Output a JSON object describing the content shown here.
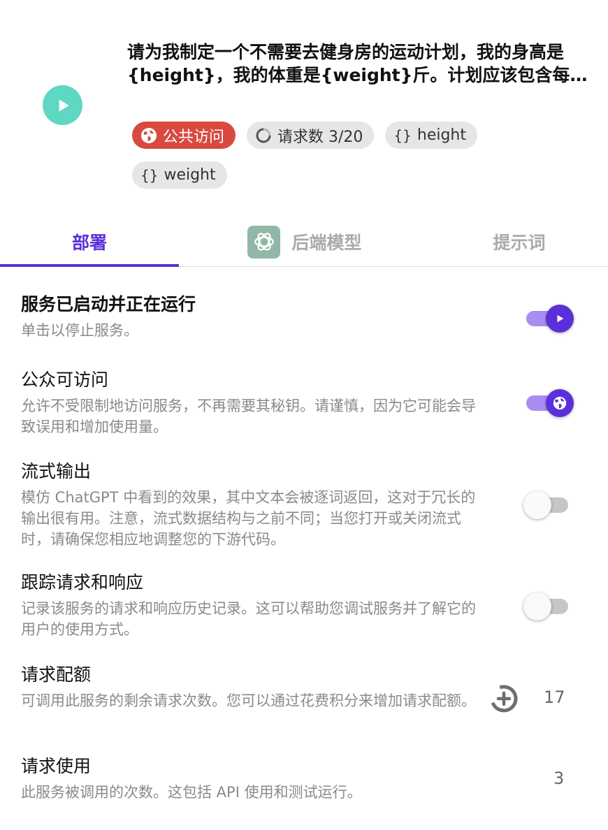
{
  "header": {
    "title": "请为我制定一个不需要去健身房的运动计划，我的身高是{height}，我的体重是{weight}斤。计划应该包含每日的运动安排和饮食建议。",
    "chips": [
      {
        "label": "公共访问",
        "icon": "globe-icon"
      },
      {
        "label": "请求数 3/20",
        "icon": "progress-circle-icon"
      },
      {
        "label": "height",
        "icon": "braces-icon"
      },
      {
        "label": "weight",
        "icon": "braces-icon"
      }
    ],
    "braces_glyph": "{}"
  },
  "tabs": [
    {
      "label": "部署",
      "active": true
    },
    {
      "label": "后端模型",
      "icon": "openai-logo-icon"
    },
    {
      "label": "提示词"
    }
  ],
  "settings": {
    "running": {
      "title": "服务已启动并正在运行",
      "desc": "单击以停止服务。",
      "on": true
    },
    "public": {
      "title": "公众可访问",
      "desc": "允许不受限制地访问服务，不再需要其秘钥。请谨慎，因为它可能会导致误用和增加使用量。",
      "on": true
    },
    "streaming": {
      "title": "流式输出",
      "desc": "模仿 ChatGPT 中看到的效果，其中文本会被逐词返回，这对于冗长的输出很有用。注意，流式数据结构与之前不同；当您打开或关闭流式时，请确保您相应地调整您的下游代码。",
      "on": false
    },
    "tracing": {
      "title": "跟踪请求和响应",
      "desc": "记录该服务的请求和响应历史记录。这可以帮助您调试服务并了解它的用户的使用方式。",
      "on": false
    },
    "quota": {
      "title": "请求配额",
      "desc": "可调用此服务的剩余请求次数。您可以通过花费积分来增加请求配额。",
      "value": "17"
    },
    "usage": {
      "title": "请求使用",
      "desc": "此服务被调用的次数。这包括 API 使用和测试运行。",
      "value": "3"
    }
  },
  "colors": {
    "accent": "#5b30db",
    "public_chip": "#d84a3f",
    "play_button": "#5fd8c3"
  }
}
